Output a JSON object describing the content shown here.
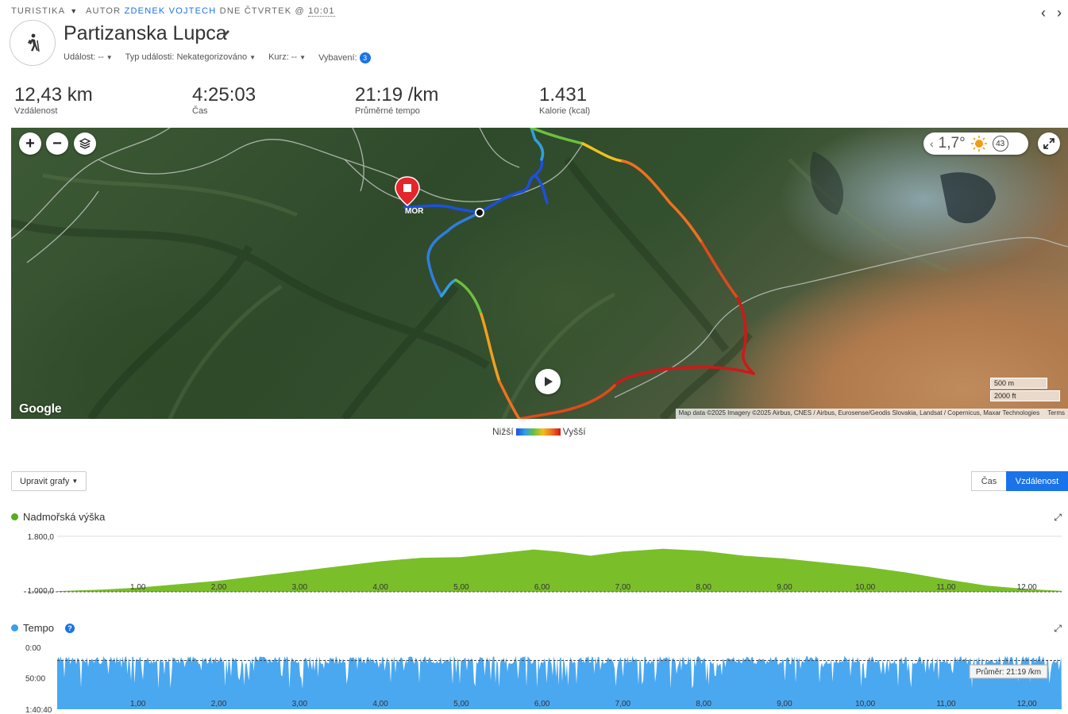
{
  "header": {
    "activity_type": "TURISTIKA",
    "author_prefix": "AUTOR",
    "author_name": "ZDENEK VOJTECH",
    "date_text": "DNE ČTVRTEK @",
    "time": "10:01",
    "prev_icon": "chevron-left-icon",
    "next_icon": "chevron-right-icon"
  },
  "activity": {
    "title": "Partizanska Lupca",
    "avatar_icon": "hiker-icon",
    "event_label": "Událost: --",
    "event_type_label": "Typ události: Nekategorizováno",
    "course_label": "Kurz: --",
    "gear_label": "Vybavení:",
    "gear_count": "3"
  },
  "stats": [
    {
      "value": "12,43 km",
      "label": "Vzdálenost"
    },
    {
      "value": "4:25:03",
      "label": "Čas"
    },
    {
      "value": "21:19 /km",
      "label": "Průměrné tempo"
    },
    {
      "value": "1.431",
      "label": "Kalorie (kcal)"
    }
  ],
  "map": {
    "zoom_in": "+",
    "zoom_out": "−",
    "temperature": "1,7°",
    "wind_speed": "43",
    "marker_label": "MOR",
    "logo": "Google",
    "attribution": "Map data ©2025 Imagery ©2025 Airbus, CNES / Airbus, Eurosense/Geodis Slovakia, Landsat / Copernicus, Maxar Technologies",
    "terms": "Terms",
    "scale_metric": "500 m",
    "scale_imperial": "2000 ft",
    "legend_low": "Nižší",
    "legend_high": "Vyšší",
    "route_colors": [
      "#1d4fe0",
      "#2fa0e0",
      "#6cc040",
      "#f0c020",
      "#f07020",
      "#d01818"
    ]
  },
  "chart_controls": {
    "edit_label": "Upravit grafy",
    "toggle_time": "Čas",
    "toggle_distance": "Vzdálenost"
  },
  "chart_data": [
    {
      "type": "area",
      "title": "Nadmořská výška",
      "color": "#7abf2a",
      "ylim": [
        1000,
        1800
      ],
      "yticks": [
        "1.800,0",
        "1.000,0"
      ],
      "xticks": [
        "1,00",
        "2,00",
        "3,00",
        "4,00",
        "5,00",
        "6,00",
        "7,00",
        "8,00",
        "9,00",
        "10,00",
        "11,00",
        "12,00"
      ],
      "x": [
        0,
        0.5,
        1,
        1.5,
        2,
        2.5,
        3,
        3.5,
        4,
        4.5,
        5,
        5.5,
        5.9,
        6.2,
        6.6,
        7.0,
        7.5,
        8.0,
        8.5,
        9.0,
        9.5,
        10,
        10.5,
        11,
        11.5,
        12,
        12.43
      ],
      "y": [
        1010,
        1030,
        1060,
        1110,
        1160,
        1230,
        1300,
        1370,
        1440,
        1490,
        1500,
        1560,
        1610,
        1580,
        1520,
        1580,
        1620,
        1590,
        1520,
        1480,
        1420,
        1360,
        1280,
        1180,
        1090,
        1040,
        1015
      ]
    },
    {
      "type": "area",
      "title": "Tempo",
      "color": "#4aa8f0",
      "yticks": [
        "0:00",
        "50:00",
        "1:40:40"
      ],
      "ylim": [
        0,
        100.67
      ],
      "xticks": [
        "1,00",
        "2,00",
        "3,00",
        "4,00",
        "5,00",
        "6,00",
        "7,00",
        "8,00",
        "9,00",
        "10,00",
        "11,00",
        "12,00"
      ],
      "average_label": "Průměr: 21:19 /km",
      "average_value": 21.32
    }
  ]
}
